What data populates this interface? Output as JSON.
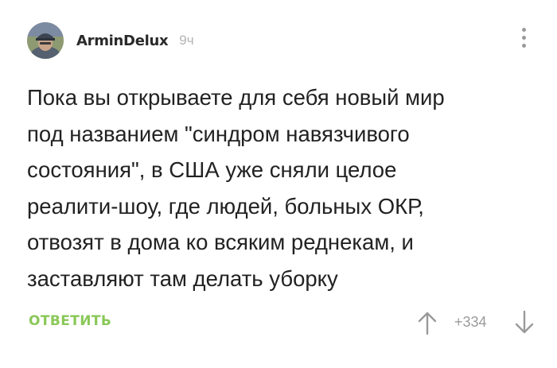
{
  "comment": {
    "author": "ArminDelux",
    "time": "9ч",
    "text_lines": [
      "Пока вы открываете для себя новый мир",
      "под названием \"синдром навязчивого",
      "состояния\", в США уже сняли целое",
      "реалити-шоу, где людей, больных ОКР,",
      "отвозят в дома ко всяким реднекам, и",
      "заставляют там делать уборку"
    ],
    "reply_label": "ОТВЕТИТЬ",
    "rating": "+334"
  },
  "icons": {
    "avatar": "avatar-icon",
    "more": "more-vertical-icon",
    "vote_up": "arrow-up-icon",
    "vote_down": "arrow-down-icon"
  },
  "colors": {
    "reply": "#8ac858",
    "muted": "#9a9a9a",
    "text": "#222222"
  }
}
